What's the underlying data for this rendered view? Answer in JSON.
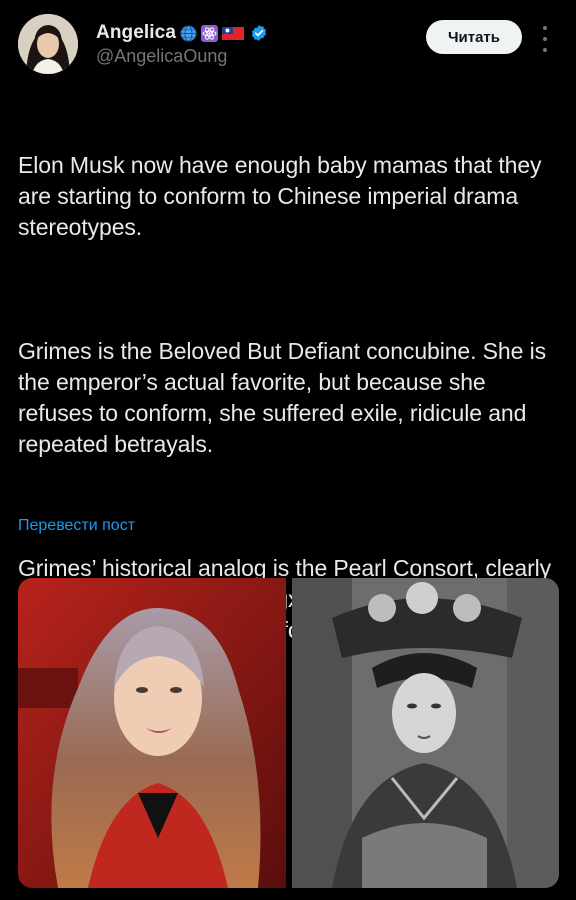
{
  "header": {
    "display_name": "Angelica",
    "emoji_icons": [
      "globe-icon",
      "atom-icon",
      "taiwan-flag-icon"
    ],
    "verified": true,
    "handle": "@AngelicaOung",
    "follow_label": "Читать"
  },
  "tweet": {
    "paragraphs": [
      "Elon Musk now have enough baby mamas that they are starting to conform to Chinese imperial drama stereotypes.",
      "Grimes is the Beloved But Defiant concubine. She is the emperor’s actual favorite, but because she refuses to conform, she suffered exile, ridicule and repeated betrayals.",
      "Grimes’ historical analog is the Pearl Consort, clearly adored by Emperor Guangxu but eventually thrown down a well and drowned for disrespecting the the Empress Dowager."
    ],
    "translate_label": "Перевести пост"
  },
  "colors": {
    "background": "#000000",
    "text": "#e7e9ea",
    "secondary": "#71767b",
    "link": "#1d9bf0",
    "verified": "#1d9bf0"
  }
}
